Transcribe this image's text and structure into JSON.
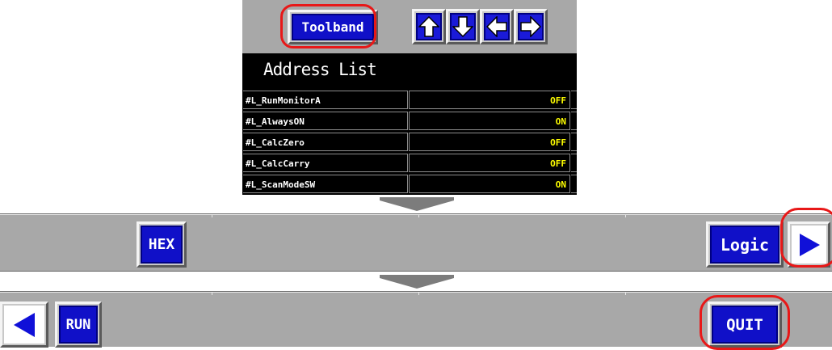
{
  "toolbar": {
    "toolband_label": "Toolband",
    "nav_icons": [
      "arrow-up-icon",
      "arrow-down-icon",
      "arrow-left-icon",
      "arrow-right-icon"
    ]
  },
  "address_list": {
    "title": "Address List",
    "rows": [
      {
        "name": "#L_RunMonitorA",
        "value": "OFF"
      },
      {
        "name": "#L_AlwaysON",
        "value": "ON"
      },
      {
        "name": "#L_CalcZero",
        "value": "OFF"
      },
      {
        "name": "#L_CalcCarry",
        "value": "OFF"
      },
      {
        "name": "#L_ScanModeSW",
        "value": "ON"
      }
    ]
  },
  "bar1": {
    "hex_label": "HEX",
    "logic_label": "Logic",
    "next_icon": "triangle-right-icon"
  },
  "bar2": {
    "prev_icon": "triangle-left-icon",
    "run_label": "RUN",
    "quit_label": "QUIT"
  },
  "colors": {
    "button_face": "#1010c8",
    "value_text": "#ffff00",
    "highlight_ring": "#e81818",
    "bar_gray": "#a8a8a8"
  }
}
